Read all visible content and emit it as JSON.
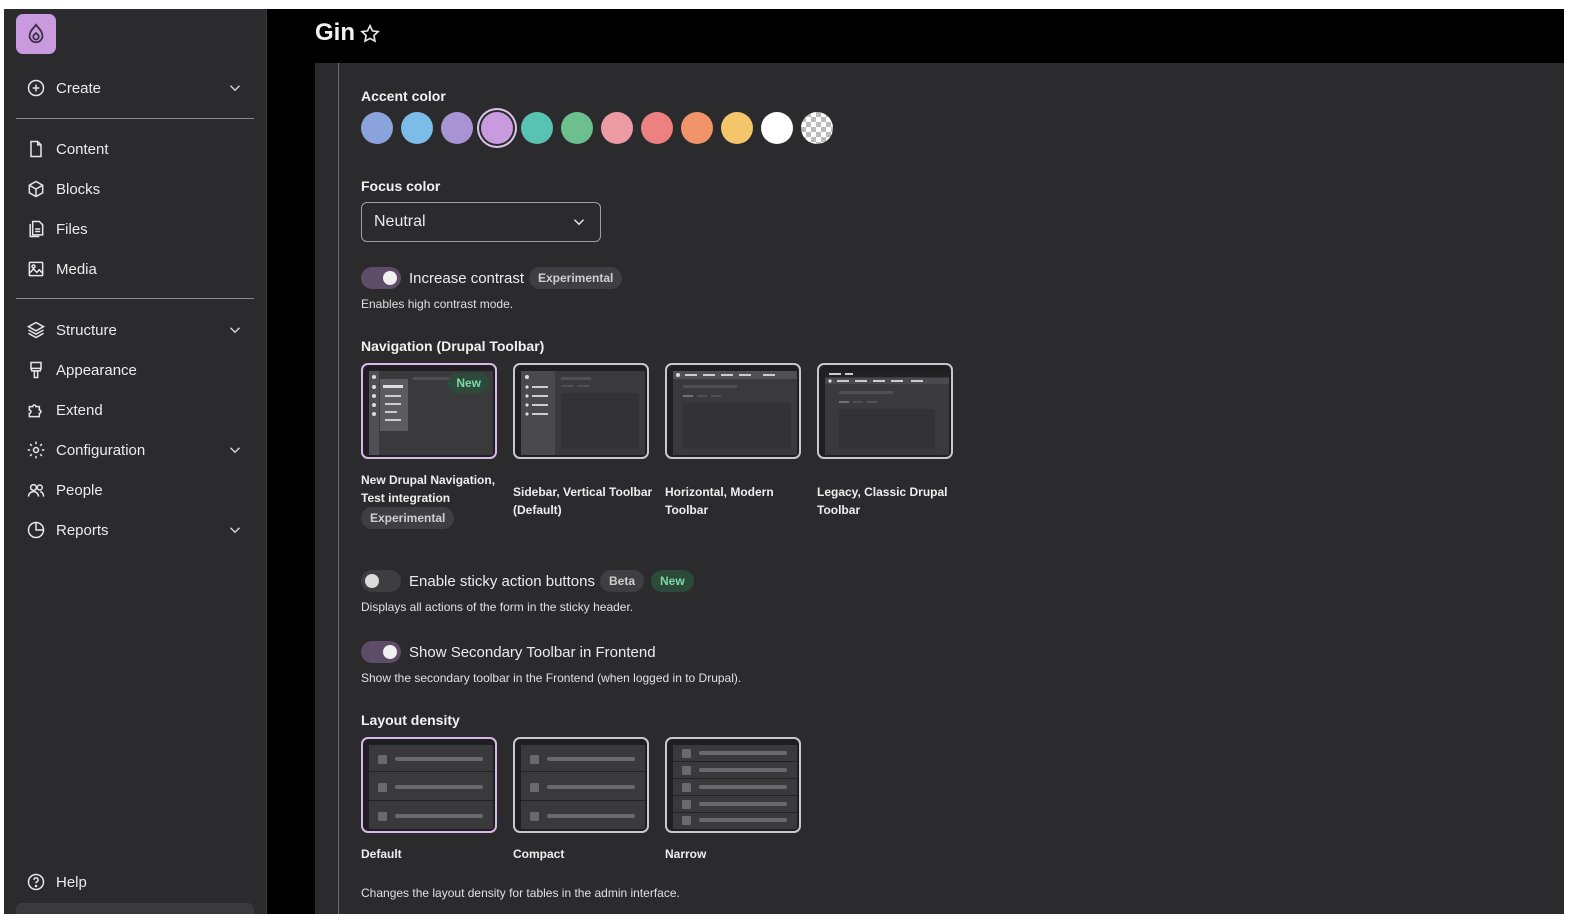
{
  "sidebar": {
    "top": [
      {
        "label": "Create",
        "icon": "plus-circle-icon",
        "has_submenu": true
      }
    ],
    "group1": [
      {
        "label": "Content",
        "icon": "document-icon"
      },
      {
        "label": "Blocks",
        "icon": "cube-icon"
      },
      {
        "label": "Files",
        "icon": "files-icon"
      },
      {
        "label": "Media",
        "icon": "image-icon"
      }
    ],
    "group2": [
      {
        "label": "Structure",
        "icon": "layers-icon",
        "has_submenu": true
      },
      {
        "label": "Appearance",
        "icon": "paint-brush-icon"
      },
      {
        "label": "Extend",
        "icon": "puzzle-icon"
      },
      {
        "label": "Configuration",
        "icon": "gear-icon",
        "has_submenu": true
      },
      {
        "label": "People",
        "icon": "people-icon"
      },
      {
        "label": "Reports",
        "icon": "pie-chart-icon",
        "has_submenu": true
      }
    ],
    "help_label": "Help"
  },
  "header": {
    "title": "Gin"
  },
  "settings": {
    "accent": {
      "label": "Accent color",
      "swatches": [
        "#8aa3dc",
        "#7cbce9",
        "#a893d3",
        "#c99bde",
        "#58c2b3",
        "#6cc08e",
        "#ec9aa4",
        "#ed8180",
        "#f2946a",
        "#f3c66a",
        "#ffffff",
        "custom"
      ],
      "selected_index": 3
    },
    "focus": {
      "label": "Focus color",
      "value": "Neutral"
    },
    "contrast": {
      "label": "Increase contrast",
      "badge": "Experimental",
      "desc": "Enables high contrast mode.",
      "on": true
    },
    "navigation": {
      "label": "Navigation (Drupal Toolbar)",
      "options": [
        {
          "line1": "New Drupal Navigation,",
          "line2": "Test integration",
          "badge": "Experimental",
          "card_badge": "New"
        },
        {
          "line1": "Sidebar, Vertical Toolbar",
          "line2": "(Default)"
        },
        {
          "line1": "Horizontal, Modern",
          "line2": "Toolbar"
        },
        {
          "line1": "Legacy, Classic Drupal",
          "line2": "Toolbar"
        }
      ]
    },
    "sticky": {
      "label": "Enable sticky action buttons",
      "badges": [
        "Beta",
        "New"
      ],
      "desc": "Displays all actions of the form in the sticky header.",
      "on": false
    },
    "secondary": {
      "label": "Show Secondary Toolbar in Frontend",
      "desc": "Show the secondary toolbar in the Frontend (when logged in to Drupal).",
      "on": true
    },
    "density": {
      "label": "Layout density",
      "options": [
        "Default",
        "Compact",
        "Narrow"
      ],
      "desc": "Changes the layout density for tables in the admin interface."
    }
  }
}
